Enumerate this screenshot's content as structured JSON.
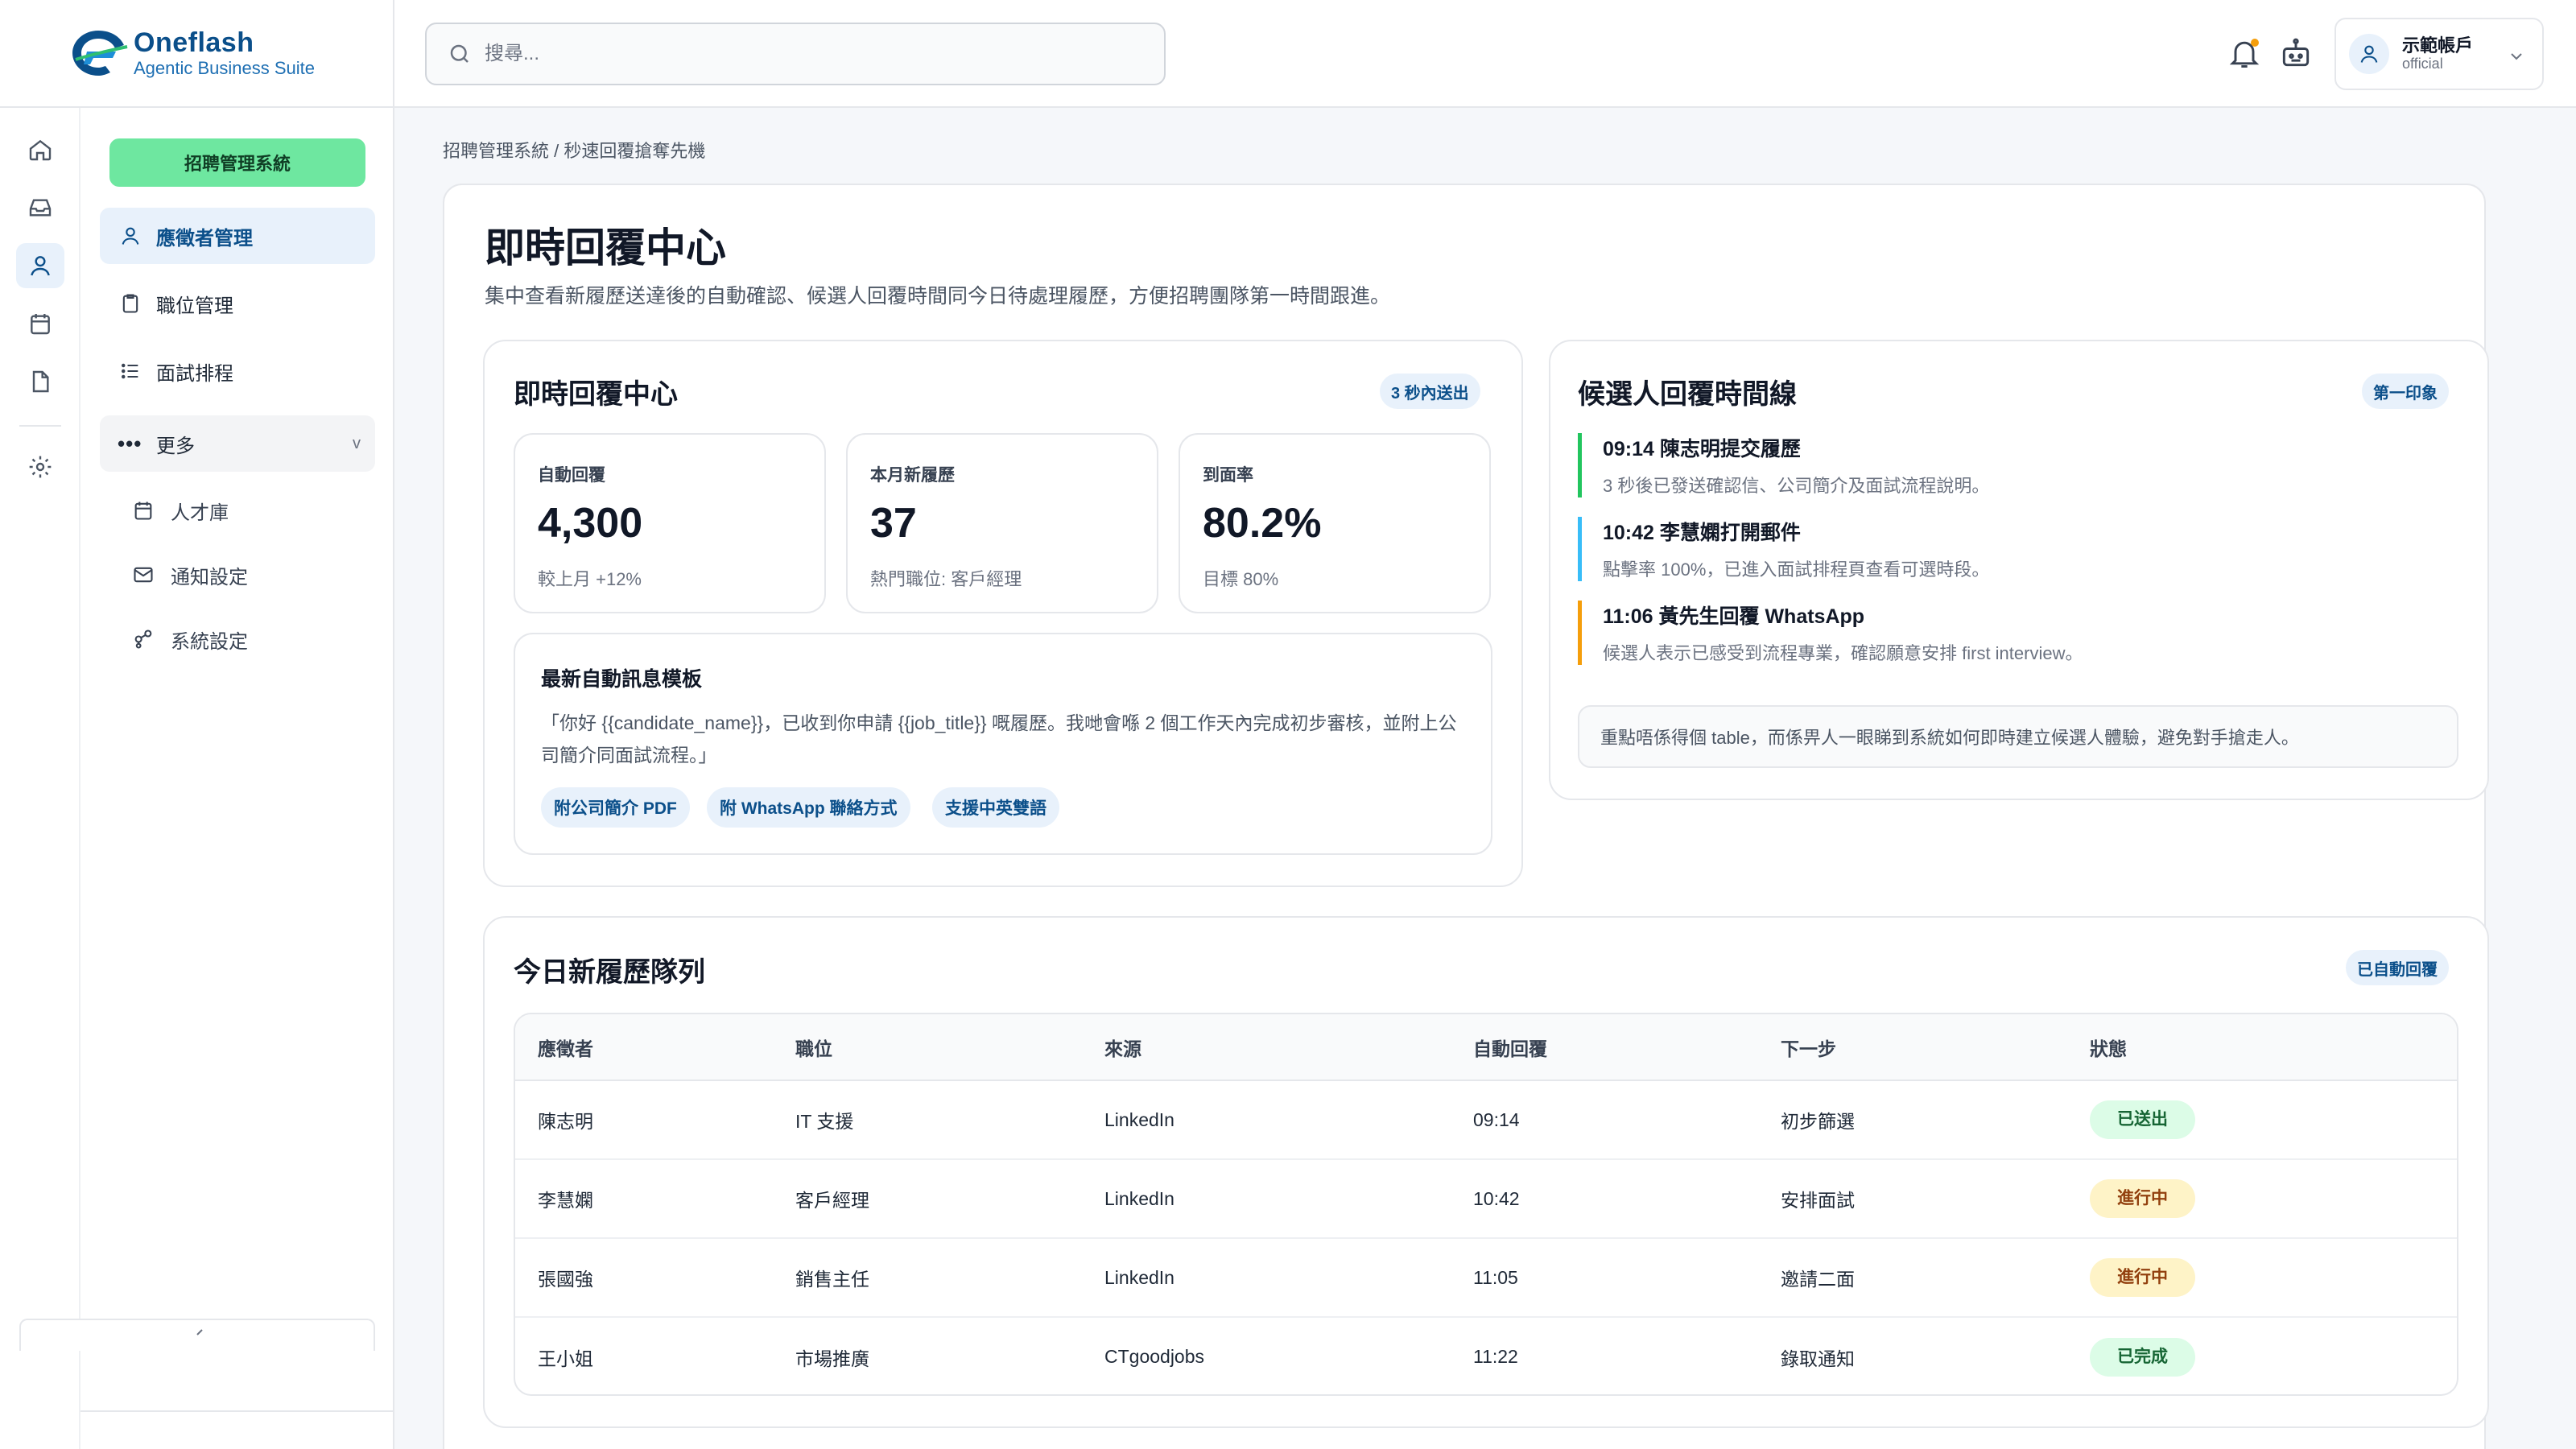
{
  "brand": {
    "name": "Oneflash",
    "tagline": "Agentic Business Suite"
  },
  "topbar": {
    "search_placeholder": "搜尋...",
    "account": {
      "name": "示範帳戶",
      "sub": "official"
    }
  },
  "sidebar": {
    "system_button": "招聘管理系統",
    "items": [
      {
        "label": "應徵者管理",
        "icon": "user-icon",
        "active": true
      },
      {
        "label": "職位管理",
        "icon": "clipboard-icon"
      },
      {
        "label": "面試排程",
        "icon": "list-icon"
      }
    ],
    "more": {
      "label": "更多",
      "caret": "v"
    },
    "sub_items": [
      {
        "label": "人才庫",
        "icon": "calendar-icon"
      },
      {
        "label": "通知設定",
        "icon": "mail-icon"
      },
      {
        "label": "系統設定",
        "icon": "share-icon"
      }
    ]
  },
  "breadcrumb": "招聘管理系統 / 秒速回覆搶奪先機",
  "page": {
    "title": "即時回覆中心",
    "description": "集中查看新履歷送達後的自動確認、候選人回覆時間同今日待處理履歷，方便招聘團隊第一時間跟進。"
  },
  "reply_center": {
    "title": "即時回覆中心",
    "badge": "3 秒內送出",
    "stats": [
      {
        "label": "自動回覆",
        "value": "4,300",
        "note": "較上月 +12%"
      },
      {
        "label": "本月新履歷",
        "value": "37",
        "note": "熱門職位: 客戶經理"
      },
      {
        "label": "到面率",
        "value": "80.2%",
        "note": "目標 80%"
      }
    ],
    "template": {
      "title": "最新自動訊息模板",
      "body": "「你好 {{candidate_name}}，已收到你申請 {{job_title}} 嘅履歷。我哋會喺 2 個工作天內完成初步審核，並附上公司簡介同面試流程。」",
      "chips": [
        "附公司簡介 PDF",
        "附 WhatsApp 聯絡方式",
        "支援中英雙語"
      ]
    }
  },
  "timeline": {
    "title": "候選人回覆時間線",
    "badge": "第一印象",
    "items": [
      {
        "head": "09:14 陳志明提交履歷",
        "desc": "3 秒後已發送確認信、公司簡介及面試流程說明。",
        "color": "#22c55e"
      },
      {
        "head": "10:42 李慧嫻打開郵件",
        "desc": "點擊率 100%，已進入面試排程頁查看可選時段。",
        "color": "#38bdf8"
      },
      {
        "head": "11:06 黃先生回覆 WhatsApp",
        "desc": "候選人表示已感受到流程專業，確認願意安排 first interview。",
        "color": "#f59e0b"
      }
    ],
    "note": "重點唔係得個 table，而係畀人一眼睇到系統如何即時建立候選人體驗，避免對手搶走人。"
  },
  "queue": {
    "title": "今日新履歷隊列",
    "badge": "已自動回覆",
    "columns": [
      "應徵者",
      "職位",
      "來源",
      "自動回覆",
      "下一步",
      "狀態"
    ],
    "rows": [
      {
        "name": "陳志明",
        "role": "IT 支援",
        "source": "LinkedIn",
        "time": "09:14",
        "next": "初步篩選",
        "status": "已送出",
        "tone": "g"
      },
      {
        "name": "李慧嫻",
        "role": "客戶經理",
        "source": "LinkedIn",
        "time": "10:42",
        "next": "安排面試",
        "status": "進行中",
        "tone": "y"
      },
      {
        "name": "張國強",
        "role": "銷售主任",
        "source": "LinkedIn",
        "time": "11:05",
        "next": "邀請二面",
        "status": "進行中",
        "tone": "y"
      },
      {
        "name": "王小姐",
        "role": "市場推廣",
        "source": "CTgoodjobs",
        "time": "11:22",
        "next": "錄取通知",
        "status": "已完成",
        "tone": "g"
      }
    ]
  },
  "colors": {
    "accent": "#0b4f8a",
    "green": "#6ee7a0",
    "badge_bg": "#e8f1fb"
  }
}
